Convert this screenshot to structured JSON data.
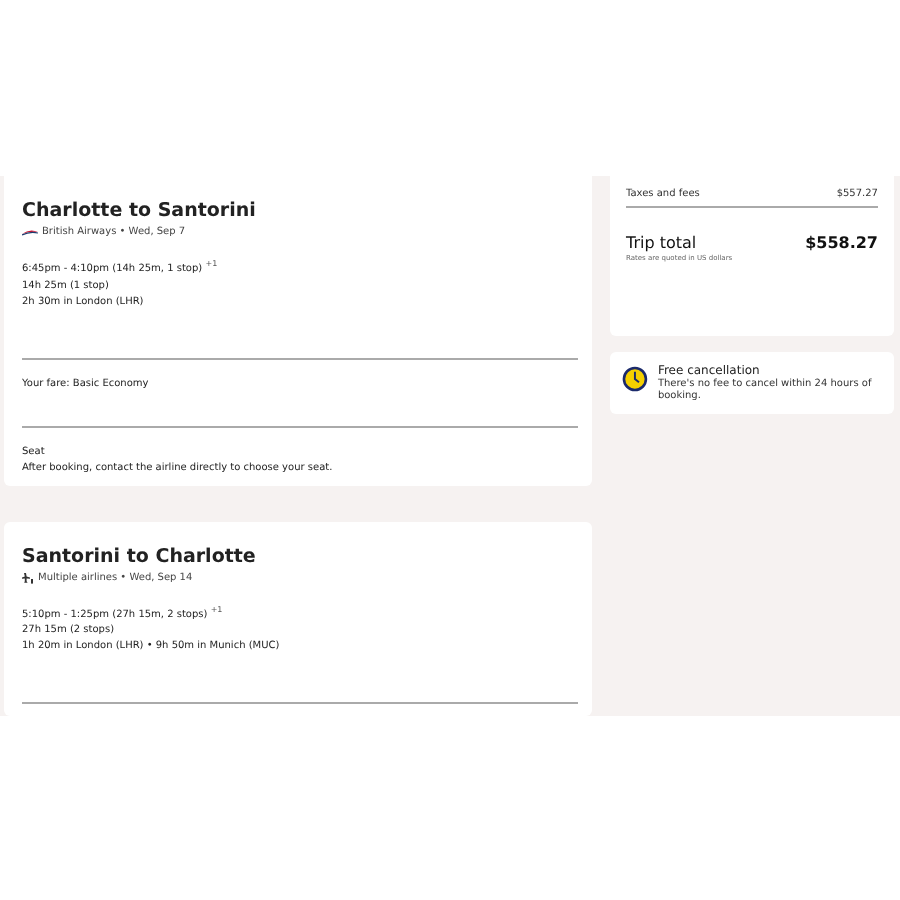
{
  "flights": [
    {
      "kind": "single",
      "title": "Charlotte to Santorini",
      "subtitle": "British Airways • Wed, Sep 7",
      "times": "6:45pm - 4:10pm (14h 25m, 1 stop)",
      "day_offset": "+1",
      "duration": "14h 25m (1 stop)",
      "layover": "2h 30m in London (LHR)",
      "fare": "Your fare: Basic Economy",
      "seat_title": "Seat",
      "seat_text": "After booking, contact the airline directly to choose your seat."
    },
    {
      "kind": "multiple",
      "title": "Santorini to Charlotte",
      "subtitle": "Multiple airlines • Wed, Sep 14",
      "times": "5:10pm - 1:25pm (27h 15m, 2 stops)",
      "day_offset": "+1",
      "duration": "27h 15m (2 stops)",
      "layover": "1h 20m in London (LHR) • 9h 50m in Munich (MUC)"
    }
  ],
  "summary": {
    "taxes_label": "Taxes and fees",
    "taxes_value": "$557.27",
    "total_label": "Trip total",
    "total_value": "$558.27",
    "note": "Rates are quoted in US dollars"
  },
  "cancellation": {
    "title": "Free cancellation",
    "text": "There's no fee to cancel within 24 hours of booking."
  }
}
